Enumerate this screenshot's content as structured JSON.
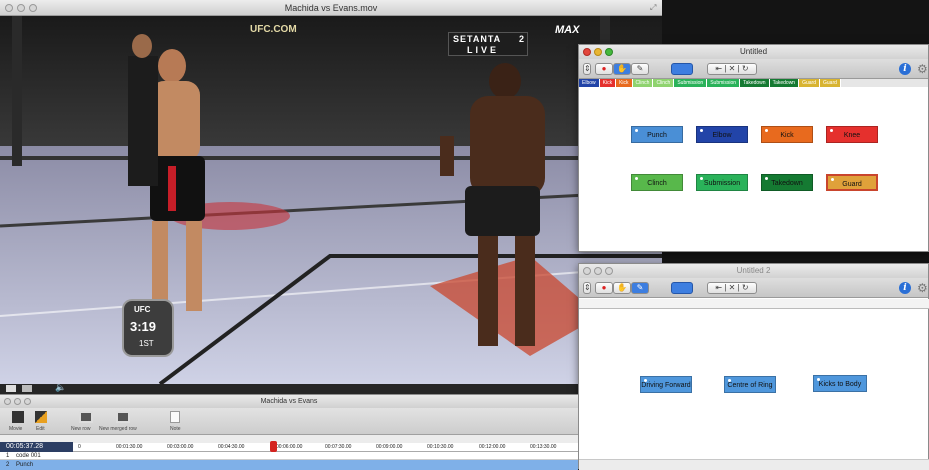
{
  "movie_window": {
    "title": "Machida vs Evans.mov",
    "overlay_top_left": "UFC.COM",
    "overlay_setanta": "SETANTA",
    "overlay_channel": "2",
    "overlay_live": "LIVE",
    "overlay_top_right": "MAX",
    "badge_ufc": "UFC",
    "badge_number": "3:19",
    "badge_round": "1ST"
  },
  "coding_window_1": {
    "title": "Untitled",
    "category_bar": [
      "Elbow",
      "Kick",
      "Kick",
      "Clinch",
      "Clinch",
      "Submission",
      "Submission",
      "Takedown",
      "Takedown",
      "Guard",
      "Guard"
    ],
    "buttons": [
      {
        "label": "Punch",
        "color": "#4a8fd6"
      },
      {
        "label": "Elbow",
        "color": "#2244a8"
      },
      {
        "label": "Kick",
        "color": "#e86a1e"
      },
      {
        "label": "Knee",
        "color": "#e5302d"
      },
      {
        "label": "Clinch",
        "color": "#58b84b"
      },
      {
        "label": "Submission",
        "color": "#2ab25a"
      },
      {
        "label": "Takedown",
        "color": "#157a32"
      },
      {
        "label": "Guard",
        "color": "#e0a13a"
      }
    ]
  },
  "coding_window_2": {
    "title": "Untitled 2",
    "buttons": [
      {
        "label": "Driving Forward",
        "color": "#4f97dc"
      },
      {
        "label": "Centre of Ring",
        "color": "#4f97dc"
      },
      {
        "label": "Kicks to Body",
        "color": "#4f97dc"
      }
    ]
  },
  "timeline_window": {
    "title": "Machida vs Evans",
    "tools": [
      "Movie",
      "Edit",
      "New row",
      "New merged row",
      "Note"
    ],
    "current_time": "00:05:37.28",
    "ruler_ticks": [
      "0",
      "00:01:30.00",
      "00:03:00.00",
      "00:04:30.00",
      "00:06:00.00",
      "00:07:30.00",
      "00:09:00.00",
      "00:10:30.00",
      "00:12:00.00",
      "00:13:30.00"
    ],
    "rows": [
      {
        "index": "1",
        "label": "code 001"
      },
      {
        "index": "2",
        "label": "Punch"
      }
    ]
  }
}
